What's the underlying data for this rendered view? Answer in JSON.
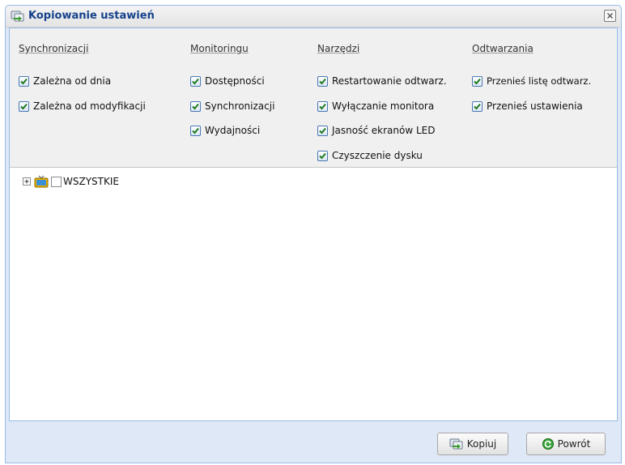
{
  "dialog": {
    "title": "Kopiowanie ustawień",
    "title_icon": "copy-settings-icon",
    "close_icon": "close-icon"
  },
  "settings": {
    "columns": [
      {
        "header": "Synchronizacji",
        "items": [
          {
            "label": "Zależna od dnia",
            "checked": true
          },
          {
            "label": "Zależna od modyfikacji",
            "checked": true
          }
        ]
      },
      {
        "header": "Monitoringu",
        "items": [
          {
            "label": "Dostępności",
            "checked": true
          },
          {
            "label": "Synchronizacji",
            "checked": true
          },
          {
            "label": "Wydajności",
            "checked": true
          }
        ]
      },
      {
        "header": "Narzędzi",
        "items": [
          {
            "label": "Restartowanie odtwarz.",
            "checked": true
          },
          {
            "label": "Wyłączanie monitora",
            "checked": true
          },
          {
            "label": "Jasność ekranów LED",
            "checked": true
          },
          {
            "label": "Czyszczenie dysku",
            "checked": true
          }
        ]
      },
      {
        "header": "Odtwarzania",
        "items": [
          {
            "label": "Przenieś listę odtwarz.",
            "checked": true
          },
          {
            "label": "Przenieś ustawienia",
            "checked": true
          }
        ]
      }
    ]
  },
  "tree": {
    "root_label": "WSZYSTKIE",
    "root_checked": false,
    "expander_icon": "tree-expand-plus-icon",
    "node_icon": "tv-player-icon"
  },
  "footer": {
    "copy_label": "Kopiuj",
    "copy_icon": "copy-settings-icon",
    "back_label": "Powrót",
    "back_icon": "refresh-back-icon"
  },
  "colors": {
    "title_text": "#15428b",
    "frame": "#dfe8f6",
    "border": "#99bbe8",
    "checkbox_check": "#1f7a1f"
  }
}
